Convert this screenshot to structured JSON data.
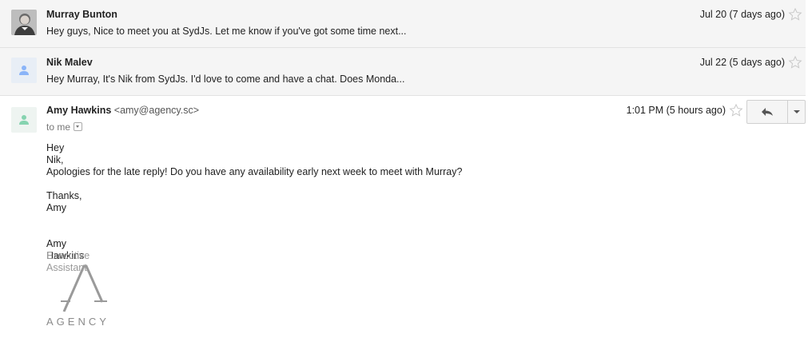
{
  "messages": [
    {
      "sender": "Murray Bunton",
      "snippet": "Hey guys, Nice to meet you at SydJs. Let me know if you've got some time next...",
      "date": "Jul 20 (7 days ago)"
    },
    {
      "sender": "Nik Malev",
      "snippet": "Hey Murray, It's Nik from SydJs. I'd love to come and have a chat. Does Monda...",
      "date": "Jul 22 (5 days ago)"
    }
  ],
  "open_message": {
    "sender": "Amy Hawkins",
    "email": "<amy@agency.sc>",
    "to": "to me",
    "date": "1:01 PM (5 hours ago)",
    "greeting": "Hey Nik,",
    "paragraph": "Apologies for the late reply! Do you have any availability early next week to meet with Murray?",
    "closing_1": "Thanks,",
    "closing_2": "Amy",
    "sig_name": "Amy Hawkins",
    "sig_title": "Executive Assistant",
    "logo_text": "AGENCY"
  },
  "icons": {
    "star": "star-icon",
    "reply": "reply-icon",
    "more": "chevron-down-icon",
    "avatar_default": "person-icon"
  },
  "colors": {
    "collapsed_bg": "#f5f5f5",
    "default_avatar_bg": "#e8eef6",
    "default_avatar_fg": "#8ab4f8",
    "open_avatar_fg": "#86d3b0",
    "secondary_text": "#999999"
  }
}
